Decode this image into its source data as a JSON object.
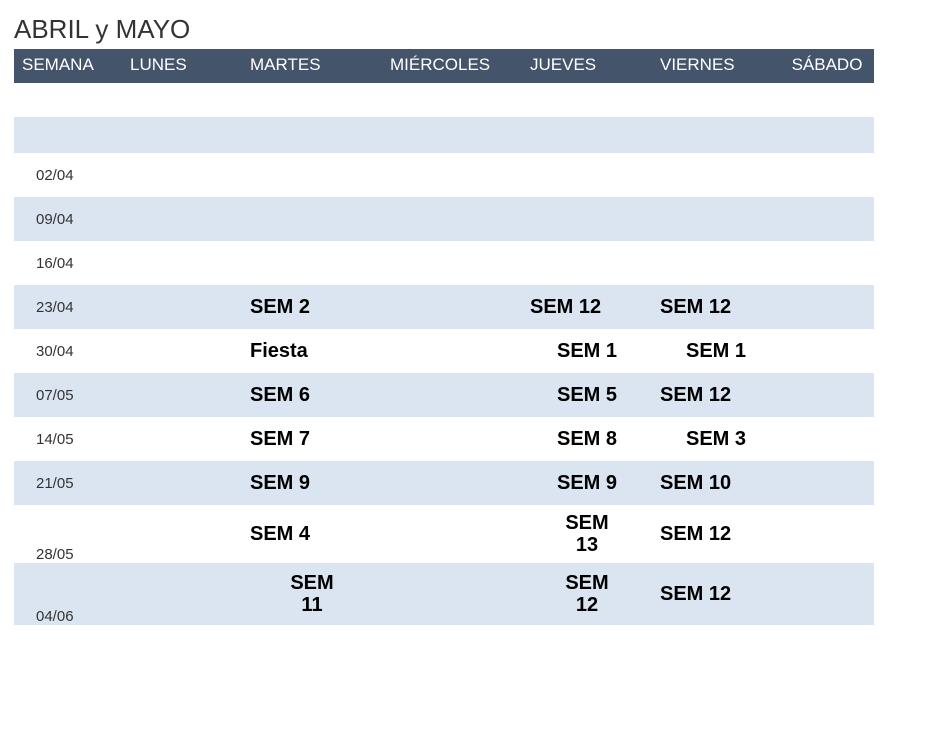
{
  "title": "ABRIL y MAYO",
  "headers": {
    "semana": "SEMANA",
    "lunes": "LUNES",
    "martes": "MARTES",
    "miercoles": "MIÉRCOLES",
    "jueves": "JUEVES",
    "viernes": "VIERNES",
    "sabado": "SÁBADO"
  },
  "rows": [
    {
      "date": "02/04",
      "martes": "",
      "jueves": "",
      "viernes": ""
    },
    {
      "date": "09/04",
      "martes": "",
      "jueves": "",
      "viernes": ""
    },
    {
      "date": "16/04",
      "martes": "",
      "jueves": "",
      "viernes": ""
    },
    {
      "date": "23/04",
      "martes": "SEM 2",
      "jueves": "SEM 12",
      "viernes": "SEM 12"
    },
    {
      "date": "30/04",
      "martes": "Fiesta",
      "jueves": "SEM 1",
      "viernes": "SEM 1"
    },
    {
      "date": "07/05",
      "martes": "SEM 6",
      "jueves": "SEM 5",
      "viernes": "SEM 12"
    },
    {
      "date": "14/05",
      "martes": "SEM 7",
      "jueves": "SEM 8",
      "viernes": "SEM 3"
    },
    {
      "date": "21/05",
      "martes": "SEM 9",
      "jueves": "SEM 9",
      "viernes": "SEM 10"
    },
    {
      "date": "28/05",
      "martes": "SEM 4",
      "jueves": "SEM 13",
      "viernes": "SEM 12"
    },
    {
      "date": "04/06",
      "martes": "SEM 11",
      "jueves": "SEM 12",
      "viernes": "SEM 12"
    }
  ]
}
